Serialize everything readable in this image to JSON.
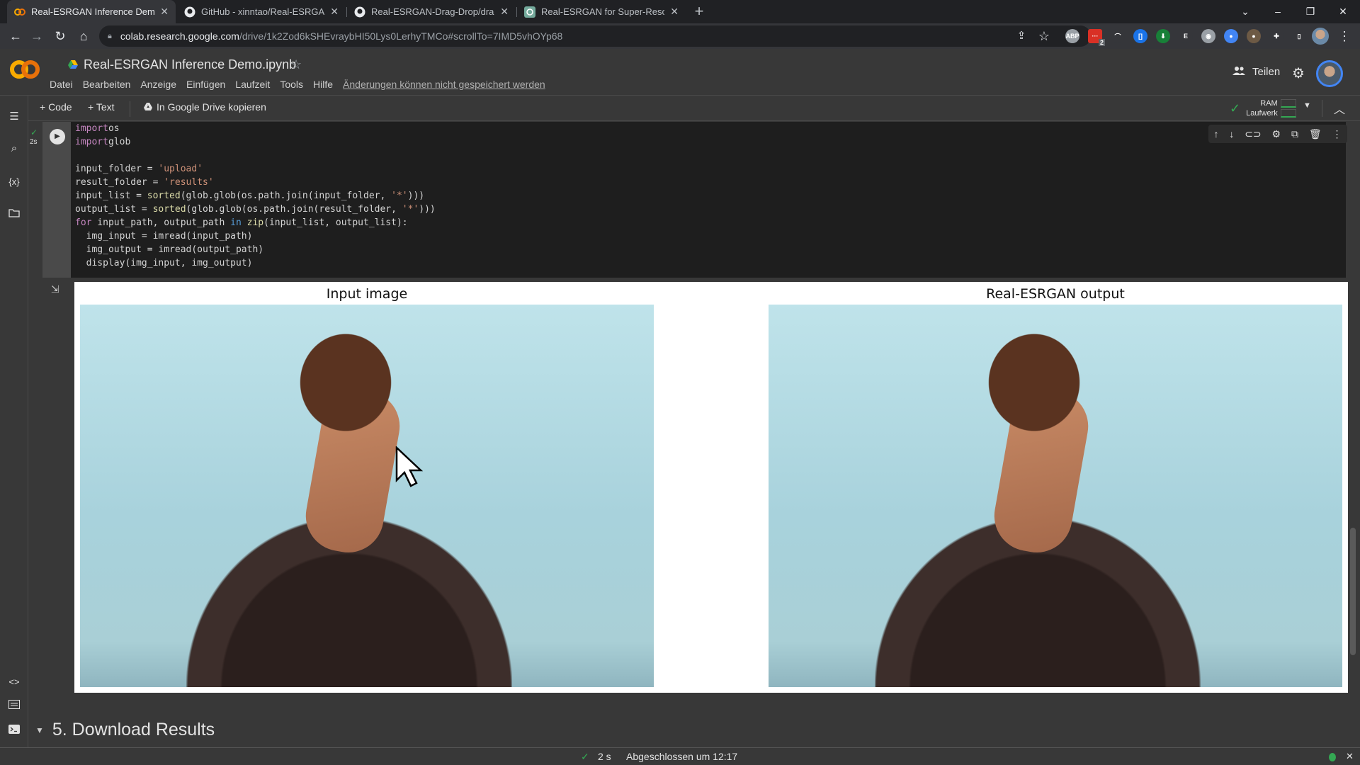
{
  "browser": {
    "tabs": [
      {
        "title": "Real-ESRGAN Inference Demo.ip",
        "icon": "colab-icon",
        "active": true
      },
      {
        "title": "GitHub - xinntao/Real-ESRGAN: ",
        "icon": "github-icon",
        "active": false
      },
      {
        "title": "Real-ESRGAN-Drag-Drop/drag&",
        "icon": "github-icon",
        "active": false
      },
      {
        "title": "Real-ESRGAN for Super-Resoluti",
        "icon": "chatgpt-icon",
        "active": false
      }
    ],
    "new_tab": "+",
    "window_controls": {
      "tab_search": "⌄",
      "minimize": "–",
      "restore": "❐",
      "close": "✕"
    },
    "url_host": "colab.research.google.com",
    "url_path": "/drive/1k2Zod6kSHEvraybHI50Lys0LerhyTMCo#scrollTo=7IMD5vhOYp68",
    "extensions": [
      {
        "name": "adblock-plus",
        "label": "ABP",
        "color": "#9aa0a6"
      },
      {
        "name": "extension-red",
        "label": "···",
        "color": "#d93025",
        "badge": "2"
      },
      {
        "name": "extension-arc",
        "label": "⌒",
        "color": "#35363a"
      },
      {
        "name": "extension-blue",
        "label": "[]",
        "color": "#1a73e8"
      },
      {
        "name": "extension-download",
        "label": "⬇",
        "color": "#188038"
      },
      {
        "name": "extension-e",
        "label": "E",
        "color": "#35363a"
      },
      {
        "name": "extension-camera",
        "label": "◉",
        "color": "#9aa0a6"
      },
      {
        "name": "extension-globe",
        "label": "●",
        "color": "#4285f4"
      },
      {
        "name": "extension-brown",
        "label": "●",
        "color": "#6d5a45"
      },
      {
        "name": "extensions-puzzle",
        "label": "✚",
        "color": "#35363a"
      },
      {
        "name": "side-panel",
        "label": "▯",
        "color": "#35363a"
      }
    ]
  },
  "colab": {
    "notebook_title": "Real-ESRGAN Inference Demo.ipynb",
    "menu": [
      "Datei",
      "Bearbeiten",
      "Anzeige",
      "Einfügen",
      "Laufzeit",
      "Tools",
      "Hilfe"
    ],
    "unsaved_warning": "Änderungen können nicht gespeichert werden",
    "share_label": "Teilen",
    "toolbar": {
      "add_code": "+ Code",
      "add_text": "+ Text",
      "copy_to_drive": "In Google Drive kopieren"
    },
    "resources": {
      "ram_label": "RAM",
      "disk_label": "Laufwerk",
      "connected": true
    },
    "cell": {
      "exec_time": "2s",
      "status": "success",
      "code_lines": [
        [
          [
            "kw",
            "import"
          ],
          [
            "",
            "os"
          ]
        ],
        [
          [
            "kw",
            "import"
          ],
          [
            "",
            "glob"
          ]
        ],
        [],
        [
          [
            "",
            "input_folder = "
          ],
          [
            "str",
            "'upload'"
          ]
        ],
        [
          [
            "",
            "result_folder = "
          ],
          [
            "str",
            "'results'"
          ]
        ],
        [
          [
            "",
            "input_list = "
          ],
          [
            "fn",
            "sorted"
          ],
          [
            "",
            "(glob.glob(os.path.join(input_folder, "
          ],
          [
            "str",
            "'*'"
          ],
          [
            "",
            ")))"
          ]
        ],
        [
          [
            "",
            "output_list = "
          ],
          [
            "fn",
            "sorted"
          ],
          [
            "",
            "(glob.glob(os.path.join(result_folder, "
          ],
          [
            "str",
            "'*'"
          ],
          [
            "",
            ")))"
          ]
        ],
        [
          [
            "kw",
            "for"
          ],
          [
            "",
            " input_path, output_path "
          ],
          [
            "kw2",
            "in"
          ],
          [
            "",
            " "
          ],
          [
            "fn",
            "zip"
          ],
          [
            "",
            "(input_list, output_list):"
          ]
        ],
        [
          [
            "",
            "  img_input = imread(input_path)"
          ]
        ],
        [
          [
            "",
            "  img_output = imread(output_path)"
          ]
        ],
        [
          [
            "",
            "  display(img_input, img_output)"
          ]
        ]
      ],
      "cell_toolbar": [
        "move-up",
        "move-down",
        "link",
        "settings",
        "mirror",
        "delete",
        "more"
      ]
    },
    "output": {
      "left_title": "Input image",
      "right_title": "Real-ESRGAN output"
    },
    "next_section": {
      "number": "5.",
      "title": "5. Download Results"
    },
    "statusbar": {
      "duration": "2 s",
      "message": "Abgeschlossen um 12:17"
    }
  }
}
